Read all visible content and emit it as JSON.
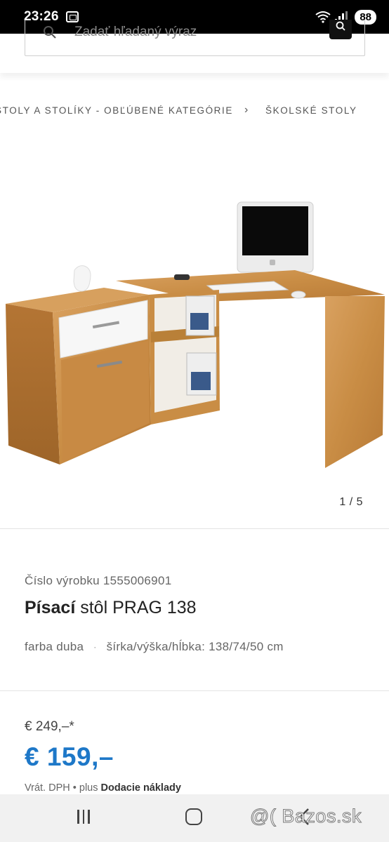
{
  "status_bar": {
    "time": "23:26",
    "battery": "88"
  },
  "search": {
    "placeholder": "Zadať hľadaný výraz"
  },
  "breadcrumb": {
    "parent": "STOLY A STOLÍKY - OBĽÚBENÉ KATEGÓRIE",
    "current": "ŠKOLSKÉ STOLY"
  },
  "gallery": {
    "counter": "1 / 5"
  },
  "product": {
    "number_label": "Číslo výrobku 1555006901",
    "title_bold": "Písací",
    "title_rest": "stôl PRAG 138",
    "color": "farba duba",
    "dimensions": "šírka/výška/hĺbka: 138/74/50 cm"
  },
  "price": {
    "old": "€ 249,–*",
    "new": "€ 159,–",
    "vat_prefix": "Vrát. DPH",
    "vat_plus": "plus",
    "shipping": "Dodacie náklady"
  },
  "watermark": "@( Bazos.sk",
  "colors": {
    "price_accent": "#1e78c8",
    "wood": "#c98d45",
    "status_bar": "#000000"
  }
}
